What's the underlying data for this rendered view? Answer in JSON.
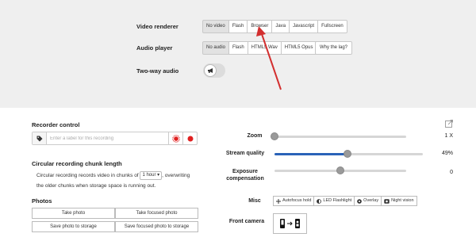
{
  "video_renderer": {
    "label": "Video renderer",
    "options": [
      "No video",
      "Flash",
      "Browser",
      "Java",
      "Javascript",
      "Fullscreen"
    ],
    "selected": "No video"
  },
  "audio_player": {
    "label": "Audio player",
    "options": [
      "No audio",
      "Flash",
      "HTML5 Wav",
      "HTML5 Opus"
    ],
    "selected": "No audio",
    "help_button": "Why the lag?"
  },
  "two_way_audio": {
    "label": "Two-way audio",
    "enabled": false,
    "icon": "megaphone-icon"
  },
  "recorder_control": {
    "title": "Recorder control",
    "input_placeholder": "Enter a label for this recording",
    "icons": [
      "tag-icon",
      "record-motion-icon",
      "record-icon"
    ],
    "record_color": "#e02020"
  },
  "circular_recording": {
    "title": "Circular recording chunk length",
    "text_before": "Circular recording records video in chunks of",
    "chunk_value": "1 hour",
    "text_after": ", overwriting",
    "text_line2": "the older chunks when storage space is running out."
  },
  "photos": {
    "title": "Photos",
    "buttons": [
      "Take photo",
      "Take focused photo",
      "Save photo to storage",
      "Save focused photo to storage"
    ]
  },
  "sliders": {
    "zoom": {
      "label": "Zoom",
      "value_text": "1 X",
      "fraction": 0.0
    },
    "stream_quality": {
      "label": "Stream quality",
      "value_text": "49%",
      "fraction": 0.49
    },
    "exposure": {
      "label": "Exposure compensation",
      "value_text": "0",
      "fraction": 0.5
    }
  },
  "misc": {
    "label": "Misc",
    "buttons": [
      {
        "label": "Autofocus hold",
        "icon": "plus-cross-icon"
      },
      {
        "label": "LED Flashlight",
        "icon": "half-circle-icon"
      },
      {
        "label": "Overlay",
        "icon": "dot-circle-icon"
      },
      {
        "label": "Night vision",
        "icon": "eye-icon"
      }
    ]
  },
  "front_camera": {
    "label": "Front camera",
    "icon": "switch-camera-icon"
  },
  "colors": {
    "accent": "#2a63b8",
    "arrow": "#d32f2f",
    "panel_bg": "#efefef"
  }
}
